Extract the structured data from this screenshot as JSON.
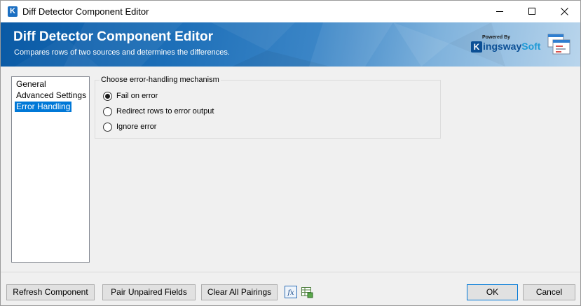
{
  "window": {
    "title": "Diff Detector Component Editor",
    "app_icon_letter": "K"
  },
  "banner": {
    "title": "Diff Detector Component Editor",
    "subtitle": "Compares rows of two sources and determines the differences.",
    "brand_powered": "Powered By",
    "brand_name_main": "ingsway",
    "brand_name_accent": "Soft",
    "brand_letter": "K"
  },
  "nav": {
    "items": [
      {
        "label": "General",
        "selected": false
      },
      {
        "label": "Advanced Settings",
        "selected": false
      },
      {
        "label": "Error Handling",
        "selected": true
      }
    ]
  },
  "error_handling": {
    "group_label": "Choose error-handling mechanism",
    "options": [
      {
        "label": "Fail on error",
        "checked": true
      },
      {
        "label": "Redirect rows to error output",
        "checked": false
      },
      {
        "label": "Ignore error",
        "checked": false
      }
    ]
  },
  "footer": {
    "refresh_label": "Refresh Component",
    "pair_label": "Pair Unpaired Fields",
    "clear_label": "Clear All Pairings",
    "fx_icon_text": "fx",
    "ok_label": "OK",
    "cancel_label": "Cancel"
  },
  "colors": {
    "selection": "#0078d7",
    "banner_dark": "#0a5aa5",
    "brand_blue": "#0b4f95",
    "brand_accent": "#1f9ad6"
  }
}
